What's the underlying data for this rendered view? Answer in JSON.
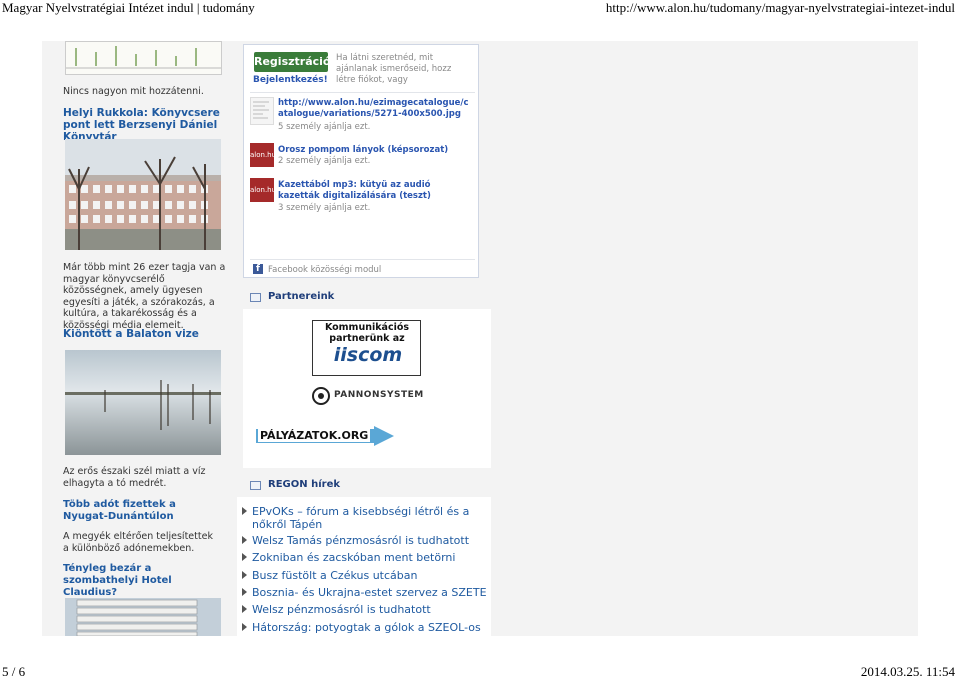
{
  "header": {
    "left": "Magyar Nyelvstratégiai Intézet indul | tudomány",
    "right": "http://www.alon.hu/tudomany/magyar-nyelvstrategiai-intezet-indul"
  },
  "footer": {
    "page": "5 / 6",
    "datetime": "2014.03.25. 11:54"
  },
  "left": {
    "no_like": "Nincs nagyon mit hozzátenni.",
    "article1_title": "Helyi Rukkola: Könyvcsere pont lett Berzsenyi Dániel Könyvtár",
    "article1_text": "Már több mint 26 ezer tagja van a magyar könyvcserélő közösségnek, amely ügyesen egyesíti a játék, a szórakozás, a kultúra, a takarékosság és a közösségi média elemeit.",
    "article2_title": "Kiöntött a Balaton vize",
    "article2_text": "Az erős északi szél miatt a víz elhagyta a tó medrét.",
    "article3_title": "Több adót fizettek a Nyugat-Dunántúlon",
    "article3_text": "A megyék eltérően teljesítettek a különböző adónemekben.",
    "article4_title": "Tényleg bezár a szombathelyi Hotel Claudius?"
  },
  "fb": {
    "register": "Regisztráció",
    "register_text": "Ha látni szeretnéd, mit ajánlanak ismerőseid, hozz létre fiókot, vagy",
    "login": "Bejelentkezés!",
    "items": [
      {
        "link": "http://www.alon.hu/ezimagecatalogue/catalogue/variations/5271-400x500.jpg",
        "count": "5 személy ajánlja ezt."
      },
      {
        "link": "Orosz pompom lányok (képsorozat)",
        "count": "2 személy ajánlja ezt."
      },
      {
        "link": "Kazettából mp3: kütyü az audió kazetták digitalizálására (teszt)",
        "count": "3 személy ajánlja ezt."
      }
    ],
    "plugin": "Facebook közösségi modul",
    "icon_label": "alon.hu"
  },
  "partners": {
    "title": "Partnereink",
    "iiscom_top": "Kommunikációs partnerünk az",
    "iiscom_logo": "iiscom",
    "pannon": "PANNONSYSTEM",
    "palyazatok": "PÁLYÁZATOK.ORG"
  },
  "regon": {
    "title": "REGON hírek",
    "items": [
      "EPvOKs – fórum a kisebbségi létről és a nőkről Tápén",
      "Welsz Tamás pénzmosásról is tudhatott",
      "Zokniban és zacskóban ment betörni",
      "Busz füstölt a Czékus utcában",
      "Bosznia- és Ukrajna-estet szervez a SZETE",
      "Welsz pénzmosásról is tudhatott",
      "Hátország: potyogtak a gólok a SZEOL-os"
    ]
  }
}
